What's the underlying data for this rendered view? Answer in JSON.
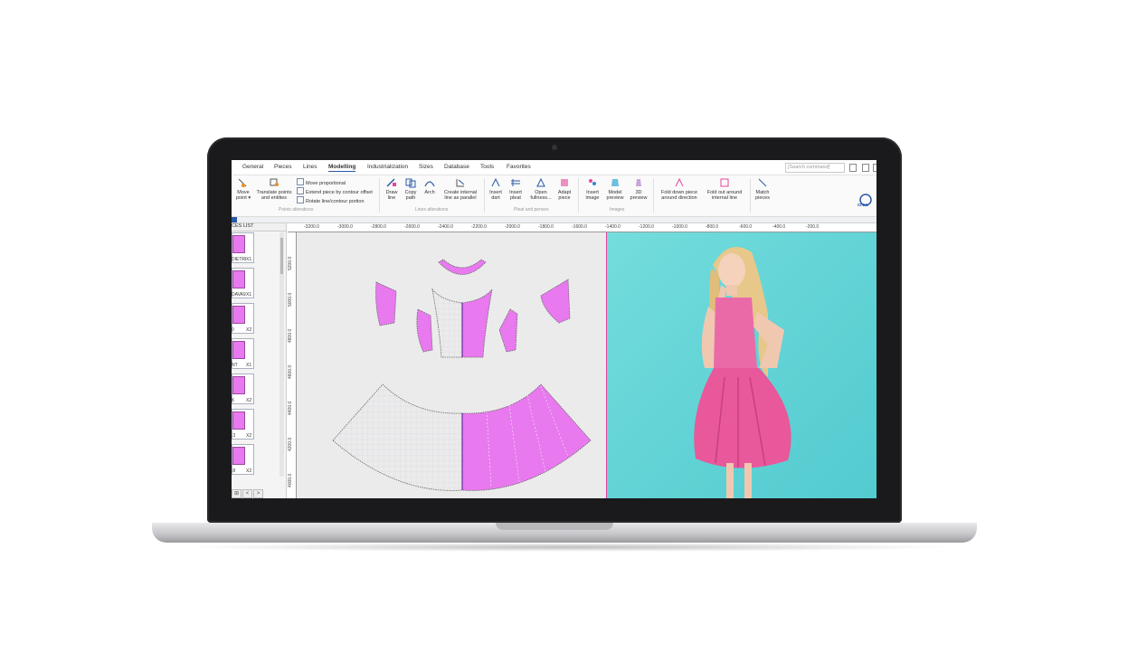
{
  "menu": {
    "tabs": [
      "General",
      "Pieces",
      "Lines",
      "Modelling",
      "Industrialization",
      "Sizes",
      "Database",
      "Tools",
      "Favorites"
    ],
    "active_tab": "Modelling",
    "search_placeholder": "[Search command]"
  },
  "ribbon": {
    "move_point": "Move point",
    "translate": "Translate points and entities",
    "move_proportional": "Move proportional",
    "extend_piece": "Extend piece by contour offset",
    "rotate_line": "Rotate line/contour portion",
    "group_points": "Points alterations",
    "draw_line": "Draw line",
    "copy_path": "Copy path",
    "arch": "Arch",
    "create_internal": "Create internal line as parallel",
    "group_lines": "Lines alterations",
    "insert_dart": "Insert dart",
    "insert_pleat": "Insert pleat",
    "open_fullness": "Open fullness...",
    "adapt_piece": "Adapt piece",
    "group_pleat": "Pleat and penses",
    "insert_image": "Insert image",
    "model_preview": "Model preview",
    "preview_3d": "3D preview",
    "group_images": "Images",
    "fold_down": "Fold down piece around direction",
    "fold_out": "Fold out around internal line",
    "match_pieces": "Match pieces",
    "logo_text": "crea"
  },
  "pieces_panel": {
    "title": "CES LIST",
    "items": [
      {
        "label": "DIETRI",
        "qty": "X1"
      },
      {
        "label": "DAVA9",
        "qty": "X1"
      },
      {
        "label": "0",
        "qty": "X2"
      },
      {
        "label": "NT",
        "qty": "X1"
      },
      {
        "label": "K",
        "qty": "X2"
      },
      {
        "label": ".3",
        "qty": "X2"
      },
      {
        "label": ".8",
        "qty": "X2"
      }
    ],
    "nav": [
      "⊞",
      "<",
      ">"
    ]
  },
  "ruler_top": [
    "-3200.0",
    "-3000.0",
    "-2800.0",
    "-2600.0",
    "-2400.0",
    "-2200.0",
    "-2000.0",
    "-1800.0",
    "-1600.0",
    "-1400.0",
    "-1200.0",
    "-1000.0",
    "-800.0",
    "-600.0",
    "-400.0",
    "-200.0"
  ],
  "ruler_left": [
    "5200.0",
    "5000.0",
    "4800.0",
    "4600.0",
    "4400.0",
    "4200.0",
    "4000.0"
  ],
  "colors": {
    "piece_fill": "#e879ee",
    "accent": "#2a58a8",
    "photo_bg": "#5fd3d6"
  }
}
